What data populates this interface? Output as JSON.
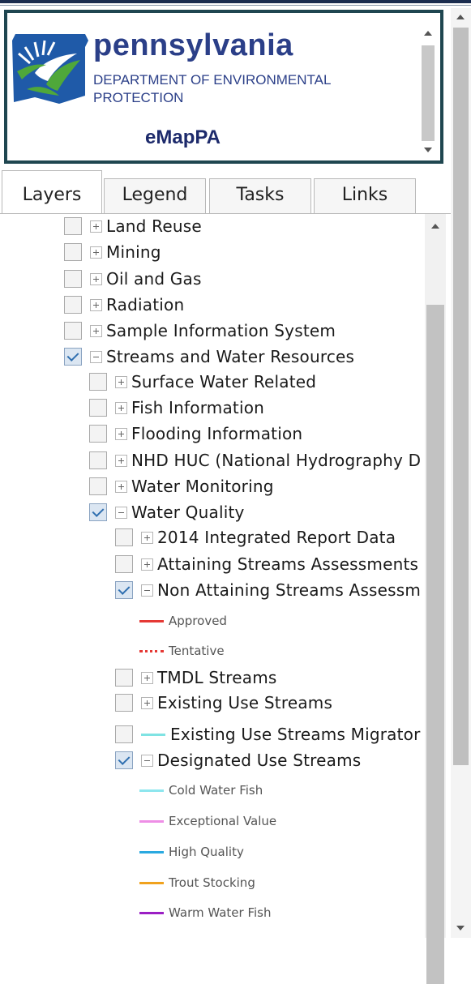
{
  "header": {
    "title": "pennsylvania",
    "subtitle_line1": "DEPARTMENT OF ENVIRONMENTAL",
    "subtitle_line2": "PROTECTION",
    "app_name": "eMapPA",
    "logo_icon": "pa-keystone-logo-icon",
    "colors": {
      "brand": "#2b3f88",
      "border": "#1f4650",
      "logo_green": "#4fa83a",
      "logo_blue": "#1f5aa8"
    }
  },
  "tabs": [
    {
      "label": "Layers",
      "active": true
    },
    {
      "label": "Legend",
      "active": false
    },
    {
      "label": "Tasks",
      "active": false
    },
    {
      "label": "Links",
      "active": false
    }
  ],
  "layers": {
    "land_reuse": {
      "label": "Land Reuse",
      "checked": false
    },
    "mining": {
      "label": "Mining",
      "checked": false
    },
    "oil_gas": {
      "label": "Oil and Gas",
      "checked": false
    },
    "radiation": {
      "label": "Radiation",
      "checked": false
    },
    "sample_info": {
      "label": "Sample Information System",
      "checked": false
    },
    "streams": {
      "label": "Streams and Water Resources",
      "checked": true
    },
    "surface_water": {
      "label": "Surface Water Related",
      "checked": false
    },
    "fish_info": {
      "label": "Fish Information",
      "checked": false
    },
    "flooding": {
      "label": "Flooding Information",
      "checked": false
    },
    "nhd_huc": {
      "label": "NHD HUC (National Hydrography D",
      "checked": false
    },
    "water_monitoring": {
      "label": "Water Monitoring",
      "checked": false
    },
    "water_quality": {
      "label": "Water Quality",
      "checked": true
    },
    "integrated_2014": {
      "label": "2014 Integrated Report Data",
      "checked": false
    },
    "attaining": {
      "label": "Attaining Streams Assessments",
      "checked": false
    },
    "non_attaining": {
      "label": "Non Attaining Streams Assessm",
      "checked": true
    },
    "tmdl": {
      "label": "TMDL Streams",
      "checked": false
    },
    "existing_use": {
      "label": "Existing Use Streams",
      "checked": false
    },
    "existing_migratory": {
      "label": "Existing Use Streams Migrator",
      "checked": false,
      "color": "#7fe3e3"
    },
    "designated_use": {
      "label": "Designated Use Streams",
      "checked": true
    }
  },
  "legends": {
    "non_attaining": [
      {
        "label": "Approved",
        "color": "#e53935",
        "style": "solid"
      },
      {
        "label": "Tentative",
        "color": "#e53935",
        "style": "dotted"
      }
    ],
    "designated_use": [
      {
        "label": "Cold Water Fish",
        "color": "#8de6ee"
      },
      {
        "label": "Exceptional Value",
        "color": "#ee8ee6"
      },
      {
        "label": "High Quality",
        "color": "#2aa9e0"
      },
      {
        "label": "Trout Stocking",
        "color": "#f0a21d"
      },
      {
        "label": "Warm Water Fish",
        "color": "#9b1fc4"
      }
    ]
  }
}
